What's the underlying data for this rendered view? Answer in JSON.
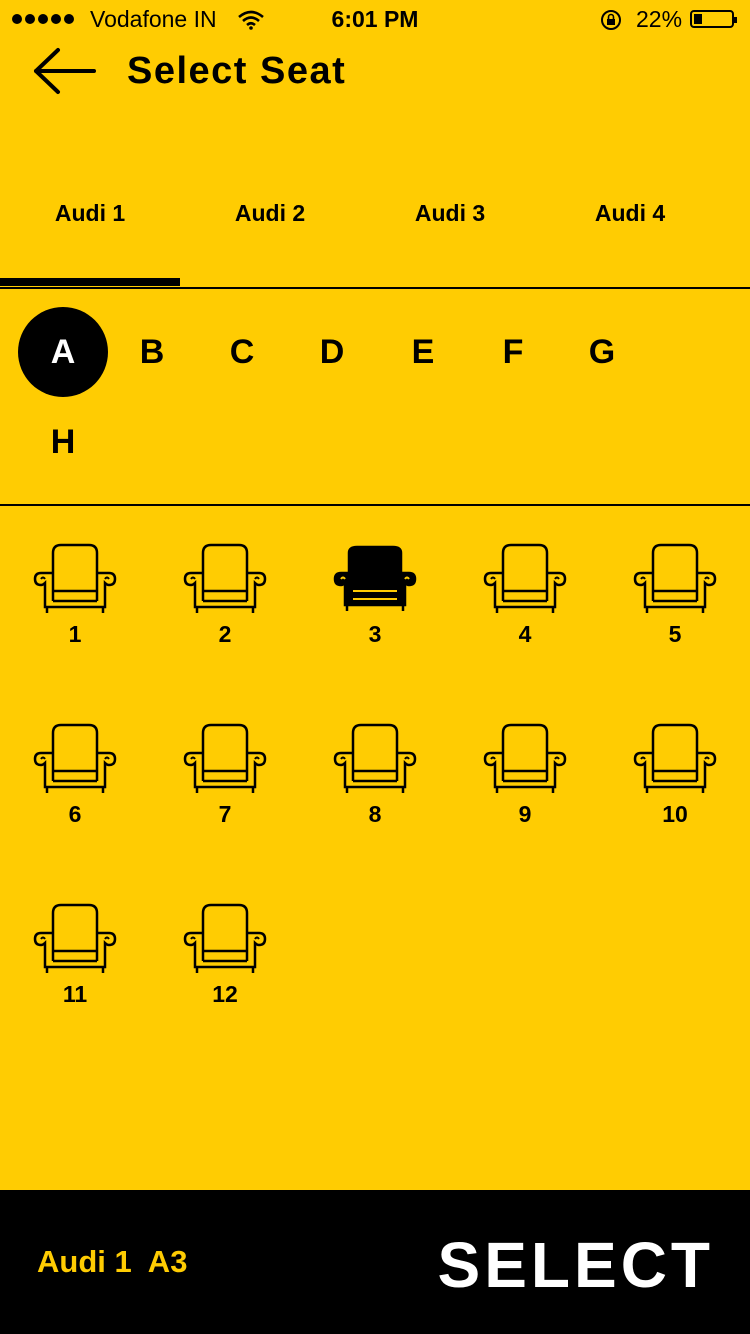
{
  "status": {
    "carrier": "Vodafone IN",
    "time": "6:01 PM",
    "battery": "22%"
  },
  "header": {
    "title": "Select Seat"
  },
  "tabs": [
    "Audi 1",
    "Audi 2",
    "Audi 3",
    "Audi 4"
  ],
  "active_tab": "Audi 1",
  "rows": [
    "A",
    "B",
    "C",
    "D",
    "E",
    "F",
    "G",
    "H"
  ],
  "active_row": "A",
  "seats": [
    "1",
    "2",
    "3",
    "4",
    "5",
    "6",
    "7",
    "8",
    "9",
    "10",
    "11",
    "12"
  ],
  "selected_seat": "3",
  "footer": {
    "selection": "Audi 1  A3",
    "select_label": "SELECT"
  },
  "colors": {
    "background": "#FFCC02",
    "foreground": "#000000",
    "accent_text": "#FFCC02"
  }
}
